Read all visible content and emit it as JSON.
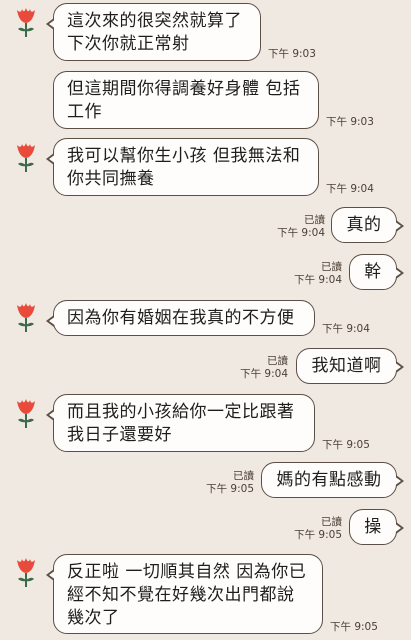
{
  "colors": {
    "background": "#efe9e1",
    "bubble": "#fffdfb",
    "bubble_border": "#5c4f46",
    "avatar_red": "#e84a3c",
    "avatar_green": "#3a6a4a"
  },
  "avatar_icon": "red-tulip-icon",
  "messages": [
    {
      "side": "in",
      "text": "這次來的很突然就算了\n下次你就正常射",
      "time": "下午 9:03"
    },
    {
      "side": "in",
      "text": "但這期間你得調養好身體 包括\n工作",
      "time": "下午 9:03"
    },
    {
      "side": "in",
      "text": "我可以幫你生小孩 但我無法和\n你共同撫養",
      "time": "下午 9:04"
    },
    {
      "side": "out",
      "text": "真的",
      "read": "已讀",
      "time": "下午 9:04"
    },
    {
      "side": "out",
      "text": "幹",
      "read": "已讀",
      "time": "下午 9:04"
    },
    {
      "side": "in",
      "text": "因為你有婚姻在我真的不方便",
      "time": "下午 9:04"
    },
    {
      "side": "out",
      "text": "我知道啊",
      "read": "已讀",
      "time": "下午 9:04"
    },
    {
      "side": "in",
      "text": "而且我的小孩給你一定比跟著\n我日子還要好",
      "time": "下午 9:05"
    },
    {
      "side": "out",
      "text": "媽的有點感動",
      "read": "已讀",
      "time": "下午 9:05"
    },
    {
      "side": "out",
      "text": "操",
      "read": "已讀",
      "time": "下午 9:05"
    },
    {
      "side": "in",
      "text": "反正啦 一切順其自然 因為你已\n經不知不覺在好幾次出門都說\n幾次了",
      "time": "下午 9:05"
    }
  ]
}
